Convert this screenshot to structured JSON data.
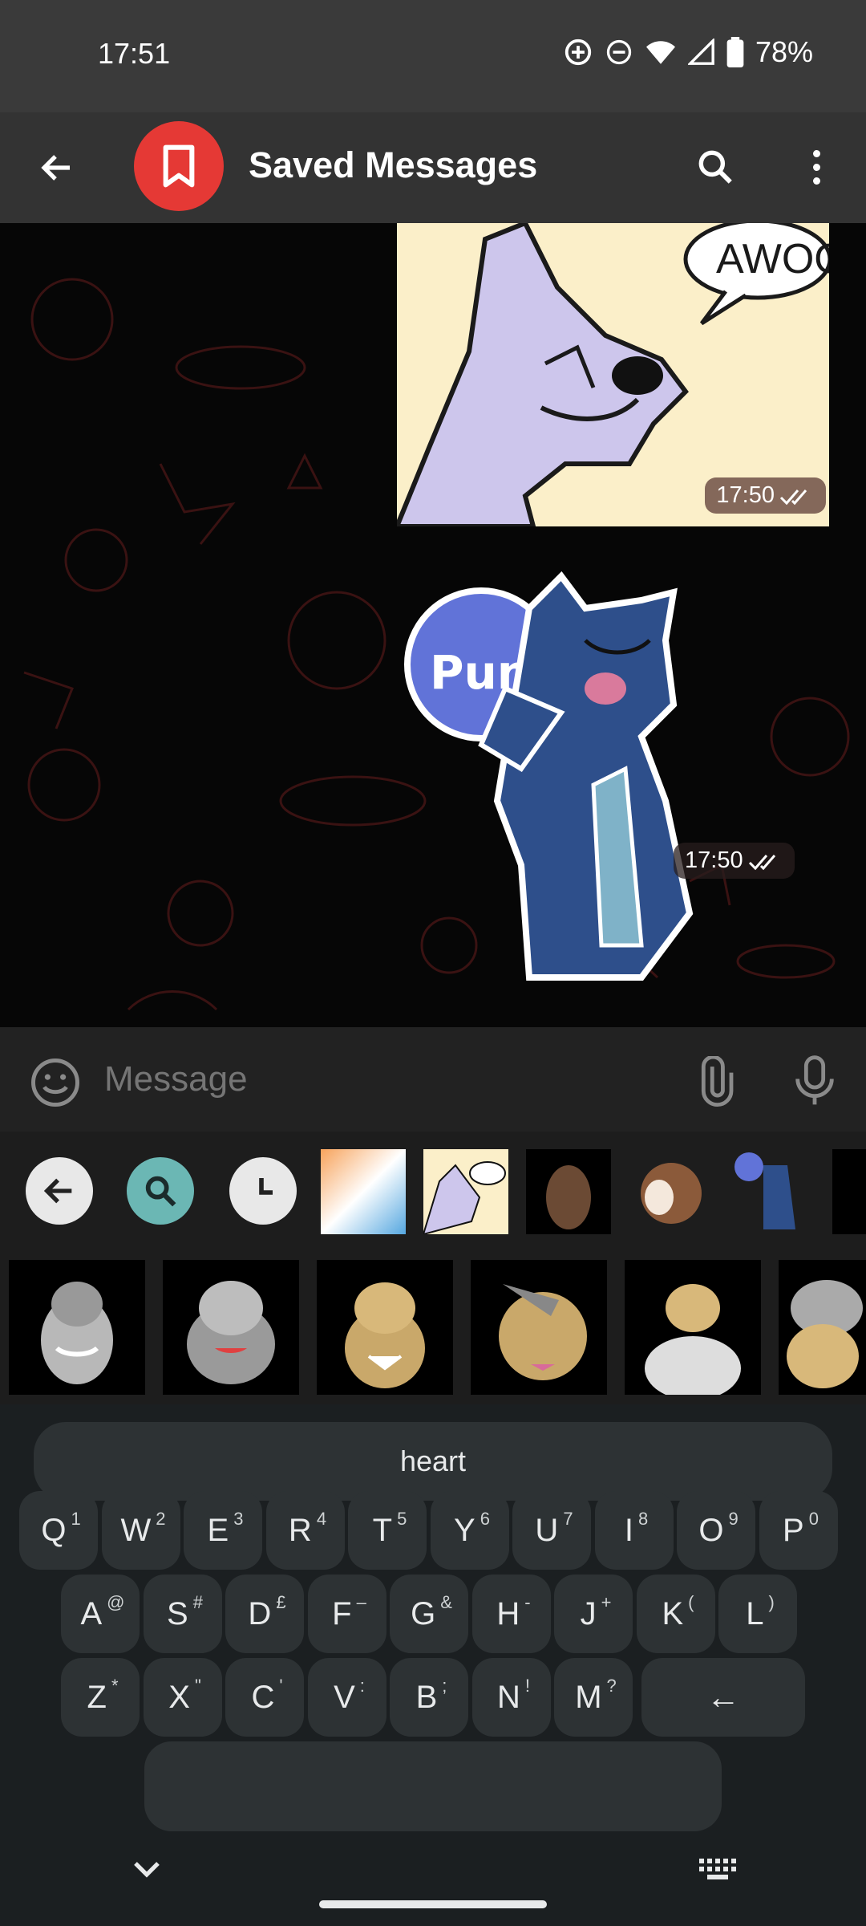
{
  "status_bar": {
    "time": "17:51",
    "battery": "78%",
    "icons": [
      "data-saver-icon",
      "do-not-disturb-icon",
      "wifi-icon",
      "signal-icon",
      "battery-icon"
    ]
  },
  "header": {
    "title": "Saved Messages",
    "avatar_color": "#e53935",
    "icons": [
      "back-arrow-icon",
      "bookmark-icon",
      "search-icon",
      "more-vert-icon"
    ]
  },
  "messages": [
    {
      "type": "image",
      "caption_text": "AWOO.",
      "time": "17:50"
    },
    {
      "type": "sticker",
      "caption_text": "Pun.",
      "time": "17:50"
    }
  ],
  "input": {
    "placeholder": "Message",
    "icons": [
      "emoji-icon",
      "attach-icon",
      "mic-icon"
    ]
  },
  "sticker_panel": {
    "tabs": [
      "back-icon",
      "search-icon",
      "recent-icon"
    ],
    "accent": "#6bb7b4"
  },
  "keyboard": {
    "suggestion": "heart",
    "row1": [
      {
        "k": "Q",
        "s": "1"
      },
      {
        "k": "W",
        "s": "2"
      },
      {
        "k": "E",
        "s": "3"
      },
      {
        "k": "R",
        "s": "4"
      },
      {
        "k": "T",
        "s": "5"
      },
      {
        "k": "Y",
        "s": "6"
      },
      {
        "k": "U",
        "s": "7"
      },
      {
        "k": "I",
        "s": "8"
      },
      {
        "k": "O",
        "s": "9"
      },
      {
        "k": "P",
        "s": "0"
      }
    ],
    "row2": [
      {
        "k": "A",
        "s": "@"
      },
      {
        "k": "S",
        "s": "#"
      },
      {
        "k": "D",
        "s": "£"
      },
      {
        "k": "F",
        "s": "–"
      },
      {
        "k": "G",
        "s": "&"
      },
      {
        "k": "H",
        "s": "-"
      },
      {
        "k": "J",
        "s": "+"
      },
      {
        "k": "K",
        "s": "("
      },
      {
        "k": "L",
        "s": ")"
      }
    ],
    "row3": [
      {
        "k": "Z",
        "s": "*"
      },
      {
        "k": "X",
        "s": "\""
      },
      {
        "k": "C",
        "s": "'"
      },
      {
        "k": "V",
        "s": ":"
      },
      {
        "k": "B",
        "s": ";"
      },
      {
        "k": "N",
        "s": "!"
      },
      {
        "k": "M",
        "s": "?"
      }
    ],
    "backspace": "←"
  }
}
